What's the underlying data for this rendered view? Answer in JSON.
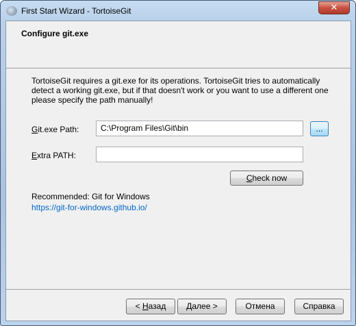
{
  "window": {
    "title": "First Start Wizard - TortoiseGit",
    "close": "✕"
  },
  "header": {
    "title": "Configure git.exe"
  },
  "description": "TortoiseGit requires a git.exe for its operations. TortoiseGit tries to automatically detect a working git.exe, but if that doesn't work or you want to use a different one please specify the path manually!",
  "git_path": {
    "label_u": "G",
    "label_rest": "it.exe Path:",
    "value": "C:\\Program Files\\Git\\bin",
    "browse": "..."
  },
  "extra_path": {
    "label_u": "E",
    "label_rest": "xtra PATH:",
    "value": ""
  },
  "check_now": {
    "u": "C",
    "rest": "heck now"
  },
  "recommended": "Recommended: Git for Windows",
  "link": "https://git-for-windows.github.io/",
  "buttons": {
    "back_pre": "< ",
    "back_u": "Н",
    "back_rest": "азад",
    "next_u": "Д",
    "next_rest": "алее >",
    "cancel": "Отмена",
    "help": "Справка"
  }
}
